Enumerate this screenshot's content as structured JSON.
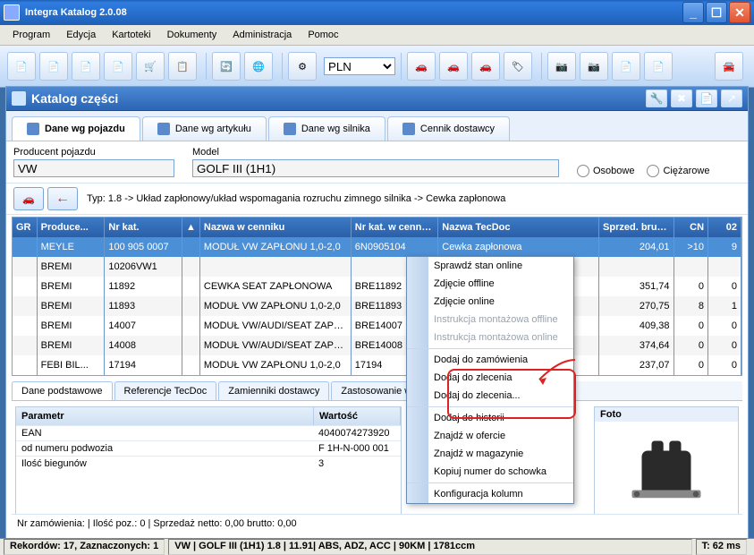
{
  "window": {
    "title": "Integra Katalog 2.0.08"
  },
  "menu": [
    "Program",
    "Edycja",
    "Kartoteki",
    "Dokumenty",
    "Administracja",
    "Pomoc"
  ],
  "currency": "PLN",
  "panel": {
    "title": "Katalog części"
  },
  "tabs": [
    {
      "label": "Dane wg pojazdu",
      "active": true
    },
    {
      "label": "Dane wg artykułu"
    },
    {
      "label": "Dane wg silnika"
    },
    {
      "label": "Cennik dostawcy"
    }
  ],
  "filters": {
    "prod_label": "Producent pojazdu",
    "prod_value": "VW",
    "model_label": "Model",
    "model_value": "GOLF III (1H1)",
    "osobowe": "Osobowe",
    "ciezarowe": "Ciężarowe"
  },
  "breadcrumb": "Typ: 1.8 -> Układ zapłonowy/układ wspomagania rozruchu zimnego silnika -> Cewka zapłonowa",
  "cols": {
    "gr": "GR",
    "prod": "Produce...",
    "nrk": "Nr kat.",
    "nazc": "Nazwa w cenniku",
    "nrkc": "Nr kat. w cenniku",
    "ntd": "Nazwa TecDoc",
    "sbr": "Sprzed. brutto",
    "cn": "CN",
    "o2": "02"
  },
  "rows": [
    {
      "prod": "MEYLE",
      "nrk": "100 905 0007",
      "nazc": "MODUŁ VW ZAPŁONU 1,0-2,0",
      "nrkc": "6N0905104",
      "ntd": "Cewka zapłonowa",
      "sbr": "204,01",
      "cn": ">10",
      "o2": "9",
      "sel": true
    },
    {
      "prod": "BREMI",
      "nrk": "10206VW1",
      "nazc": "",
      "nrkc": "",
      "ntd": "",
      "sbr": "",
      "cn": "",
      "o2": ""
    },
    {
      "prod": "BREMI",
      "nrk": "11892",
      "nazc": "CEWKA SEAT ZAPŁONOWA",
      "nrkc": "BRE11892",
      "ntd": "",
      "sbr": "351,74",
      "cn": "0",
      "o2": "0"
    },
    {
      "prod": "BREMI",
      "nrk": "11893",
      "nazc": "MODUŁ VW ZAPŁONU 1,0-2,0",
      "nrkc": "BRE11893",
      "ntd": "",
      "sbr": "270,75",
      "cn": "8",
      "o2": "1"
    },
    {
      "prod": "BREMI",
      "nrk": "14007",
      "nazc": "MODUŁ VW/AUDI/SEAT ZAPŁONU",
      "nrkc": "BRE14007",
      "ntd": "",
      "sbr": "409,38",
      "cn": "0",
      "o2": "0"
    },
    {
      "prod": "BREMI",
      "nrk": "14008",
      "nazc": "MODUŁ VW/AUDI/SEAT ZAPŁONU",
      "nrkc": "BRE14008",
      "ntd": "",
      "sbr": "374,64",
      "cn": "0",
      "o2": "0"
    },
    {
      "prod": "FEBI BIL...",
      "nrk": "17194",
      "nazc": "MODUŁ VW ZAPŁONU 1,0-2,0",
      "nrkc": "17194",
      "ntd": "",
      "sbr": "237,07",
      "cn": "0",
      "o2": "0"
    }
  ],
  "detail_tabs": [
    "Dane podstawowe",
    "Referencje TecDoc",
    "Zamienniki dostawcy",
    "Zastosowanie w pojaz"
  ],
  "param": {
    "hdr_l": "Parametr",
    "hdr_r": "Wartość",
    "rows": [
      {
        "l": "EAN",
        "r": "4040074273920"
      },
      {
        "l": "od numeru podwozia",
        "r": "F 1H-N-000 001"
      },
      {
        "l": "Ilość biegunów",
        "r": "3"
      }
    ]
  },
  "foto_label": "Foto",
  "summary": "Nr zamówienia:   |  Ilość poz.: 0  |  Sprzedaż netto: 0,00  brutto: 0,00",
  "status": {
    "rec": "Rekordów: 17, Zaznaczonych: 1",
    "veh": "VW | GOLF III (1H1) 1.8 | 11.91| ABS, ADZ, ACC | 90KM | 1781ccm",
    "time": "T: 62 ms"
  },
  "ctx": [
    {
      "l": "Sprawdź stan online"
    },
    {
      "l": "Zdjęcie offline"
    },
    {
      "l": "Zdjęcie online"
    },
    {
      "l": "Instrukcja montażowa offline",
      "dis": true
    },
    {
      "l": "Instrukcja montażowa online",
      "dis": true,
      "sep": true
    },
    {
      "l": "Dodaj do zamówienia"
    },
    {
      "l": "Dodaj do zlecenia"
    },
    {
      "l": "Dodaj do zlecenia...",
      "sep": true
    },
    {
      "l": "Dodaj do historii"
    },
    {
      "l": "Znajdź w ofercie"
    },
    {
      "l": "Znajdź w magazynie"
    },
    {
      "l": "Kopiuj numer do schowka",
      "sep": true
    },
    {
      "l": "Konfiguracja kolumn"
    }
  ]
}
